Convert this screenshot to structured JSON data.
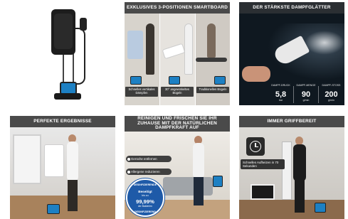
{
  "tiles": {
    "product": {},
    "smartboard": {
      "banner": "EXKLUSIVES 3-POSITIONEN SMARTBOARD",
      "captions": [
        "Schnelles vertikales Dämpfen",
        "30° angewinkeltes Bügeln",
        "Traditionelles Bügeln"
      ]
    },
    "steam": {
      "banner": "DER STÄRKSTE DAMPFGLÄTTER",
      "stats": [
        {
          "label": "DAMPF-DRUCK",
          "value": "5,8",
          "unit": "bar"
        },
        {
          "label": "DAMPF-MENGE",
          "value": "90",
          "unit": "g/min"
        },
        {
          "label": "DAMPF-STOSS",
          "value": "200",
          "unit": "g/min"
        }
      ]
    },
    "results": {
      "banner": "PERFEKTE ERGEBNISSE"
    },
    "clean": {
      "banner": "REINIGEN UND FRISCHEN SIE IHR ZUHAUSE MIT DER NATÜRLICHEN DAMPFKRAFT AUF",
      "pills": [
        "Gerüche entfernen",
        "Allergene reduzieren"
      ],
      "seal": {
        "top": "DESINFIZIERENDE",
        "line1": "Beseitigt",
        "line2": "bis zu",
        "percent": "99,99%",
        "sub": "der Bakterien",
        "bottom": "DESINFIZIEREND"
      }
    },
    "ready": {
      "banner": "IMMER GRIFFBEREIT",
      "note": "Schnelles Aufheizen in 70 Sekunden"
    }
  },
  "colors": {
    "banner_bg": "#4a4a4a",
    "tank_blue": "#1d80c3",
    "seal_blue": "#1e5aa8"
  }
}
